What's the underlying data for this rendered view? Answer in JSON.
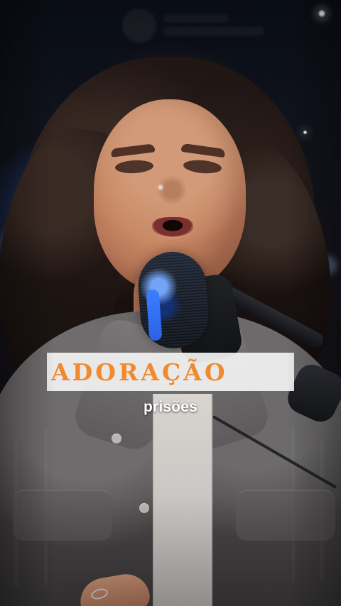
{
  "overlay": {
    "title": "ADORAÇÃO",
    "caption": "prisões"
  },
  "colors": {
    "title_text": "#f08a2d",
    "title_background": "#f2f2f2",
    "caption_text": "#ffffff"
  }
}
